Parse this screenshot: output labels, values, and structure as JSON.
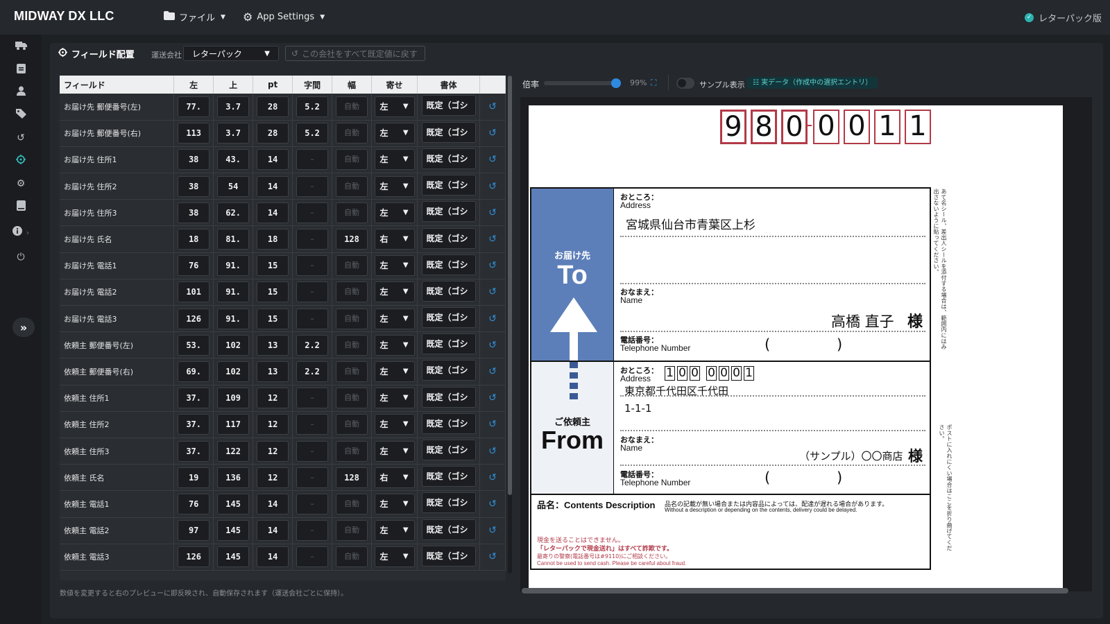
{
  "app": {
    "brand": "MIDWAY DX LLC",
    "menu_file": "ファイル",
    "menu_settings": "App Settings",
    "edition": "レターパック版"
  },
  "sidebar": {
    "items": [
      "truck-icon",
      "clipboard-icon",
      "user-icon",
      "tag-icon",
      "history-icon",
      "crosshair-icon",
      "gear-icon",
      "book-icon",
      "info-icon",
      "power-icon"
    ],
    "active": "crosshair-icon"
  },
  "panel": {
    "title": "フィールド配置",
    "carrier_label": "運送会社",
    "carrier_value": "レターパック",
    "reset_all": "この会社をすべて既定値に戻す",
    "footer_note": "数値を変更すると右のプレビューに即反映され、自動保存されます（運送会社ごとに保持）。"
  },
  "table": {
    "headers": [
      "フィールド",
      "左",
      "上",
      "pt",
      "字間",
      "幅",
      "寄せ",
      "書体"
    ],
    "rows": [
      {
        "field": "お届け先 郵便番号(左)",
        "left": "77.",
        "top": "3.7",
        "pt": "28",
        "spacing": "5.2",
        "width": "自動",
        "align": "左",
        "font": "既定（ゴシ"
      },
      {
        "field": "お届け先 郵便番号(右)",
        "left": "113",
        "top": "3.7",
        "pt": "28",
        "spacing": "5.2",
        "width": "自動",
        "align": "左",
        "font": "既定（ゴシ"
      },
      {
        "field": "お届け先 住所1",
        "left": "38",
        "top": "43.",
        "pt": "14",
        "spacing": "–",
        "width": "自動",
        "align": "左",
        "font": "既定（ゴシ"
      },
      {
        "field": "お届け先 住所2",
        "left": "38",
        "top": "54",
        "pt": "14",
        "spacing": "–",
        "width": "自動",
        "align": "左",
        "font": "既定（ゴシ"
      },
      {
        "field": "お届け先 住所3",
        "left": "38",
        "top": "62.",
        "pt": "14",
        "spacing": "–",
        "width": "自動",
        "align": "左",
        "font": "既定（ゴシ"
      },
      {
        "field": "お届け先 氏名",
        "left": "18",
        "top": "81.",
        "pt": "18",
        "spacing": "–",
        "width": "128",
        "align": "右",
        "font": "既定（ゴシ"
      },
      {
        "field": "お届け先 電話1",
        "left": "76",
        "top": "91.",
        "pt": "15",
        "spacing": "–",
        "width": "自動",
        "align": "左",
        "font": "既定（ゴシ"
      },
      {
        "field": "お届け先 電話2",
        "left": "101",
        "top": "91.",
        "pt": "15",
        "spacing": "–",
        "width": "自動",
        "align": "左",
        "font": "既定（ゴシ"
      },
      {
        "field": "お届け先 電話3",
        "left": "126",
        "top": "91.",
        "pt": "15",
        "spacing": "–",
        "width": "自動",
        "align": "左",
        "font": "既定（ゴシ"
      },
      {
        "field": "依頼主 郵便番号(左)",
        "left": "53.",
        "top": "102",
        "pt": "13",
        "spacing": "2.2",
        "width": "自動",
        "align": "左",
        "font": "既定（ゴシ"
      },
      {
        "field": "依頼主 郵便番号(右)",
        "left": "69.",
        "top": "102",
        "pt": "13",
        "spacing": "2.2",
        "width": "自動",
        "align": "左",
        "font": "既定（ゴシ"
      },
      {
        "field": "依頼主 住所1",
        "left": "37.",
        "top": "109",
        "pt": "12",
        "spacing": "–",
        "width": "自動",
        "align": "左",
        "font": "既定（ゴシ"
      },
      {
        "field": "依頼主 住所2",
        "left": "37.",
        "top": "117",
        "pt": "12",
        "spacing": "–",
        "width": "自動",
        "align": "左",
        "font": "既定（ゴシ"
      },
      {
        "field": "依頼主 住所3",
        "left": "37.",
        "top": "122",
        "pt": "12",
        "spacing": "–",
        "width": "自動",
        "align": "左",
        "font": "既定（ゴシ"
      },
      {
        "field": "依頼主 氏名",
        "left": "19",
        "top": "136",
        "pt": "12",
        "spacing": "–",
        "width": "128",
        "align": "右",
        "font": "既定（ゴシ"
      },
      {
        "field": "依頼主 電話1",
        "left": "76",
        "top": "145",
        "pt": "14",
        "spacing": "–",
        "width": "自動",
        "align": "左",
        "font": "既定（ゴシ"
      },
      {
        "field": "依頼主 電話2",
        "left": "97",
        "top": "145",
        "pt": "14",
        "spacing": "–",
        "width": "自動",
        "align": "左",
        "font": "既定（ゴシ"
      },
      {
        "field": "依頼主 電話3",
        "left": "126",
        "top": "145",
        "pt": "14",
        "spacing": "–",
        "width": "自動",
        "align": "左",
        "font": "既定（ゴシ"
      }
    ]
  },
  "preview": {
    "zoom_label": "倍率",
    "zoom_value": "99%",
    "zoom_fraction": 0.99,
    "sample_label": "サンプル表示",
    "sample_on": false,
    "data_badge": "実データ（作成中の選択エントリ）"
  },
  "label": {
    "to_zip": [
      "9",
      "8",
      "0",
      "0",
      "0",
      "1",
      "1"
    ],
    "to_jp": "お届け先",
    "to_en": "To",
    "from_jp": "ご依頼主",
    "from_en": "From",
    "address_jp": "おところ：",
    "address_en": "Address",
    "name_jp": "おなまえ：",
    "name_en": "Name",
    "phone_jp": "電話番号：",
    "phone_en": "Telephone Number",
    "to_address": "宮城県仙台市青葉区上杉",
    "to_name": "高橋 直子",
    "honorific": "様",
    "paren_open": "(",
    "paren_close": ")",
    "from_zip": [
      "1",
      "0",
      "0",
      "0",
      "0",
      "0",
      "1"
    ],
    "from_address1": "東京都千代田区千代田",
    "from_address2": "1-1-1",
    "from_name": "（サンプル）〇〇商店",
    "contents_title": "品名：Contents Description",
    "contents_note": "品名の記載が無い場合または内容品によっては、配達が遅れる場合があります。",
    "contents_note_en": "Without a description or depending on the contents, delivery could be delayed.",
    "warn1": "現金を送ることはできません。",
    "warn2": "「レターパックで現金送れ」はすべて詐欺です。",
    "warn3": "最寄りの警察(電話番号は#9110)にご相談ください。",
    "warn4": "Cannot be used to send cash. Please be careful about fraud.",
    "side_text_1": "あて名シール、差出人シールを添付する場合は、範囲内にはみ出さないように貼ってください。",
    "side_text_2": "ポストに入れにくい場合はここを折り曲げてください。"
  },
  "colors": {
    "accent": "#2f8fd8",
    "teal": "#34b6b6",
    "to_panel": "#5c7fb9",
    "zip_border": "#b23a48"
  }
}
